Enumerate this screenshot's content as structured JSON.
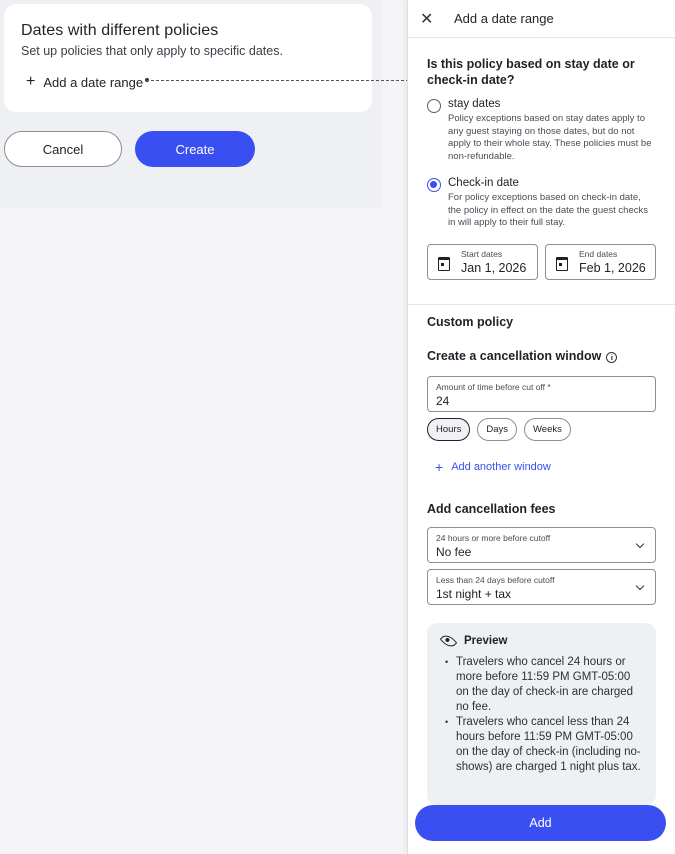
{
  "main": {
    "card_title": "Dates with different policies",
    "card_subtitle": "Set up policies that only apply to specific dates.",
    "add_date_range": "Add a date range",
    "cancel_label": "Cancel",
    "create_label": "Create"
  },
  "drawer": {
    "title": "Add a date range",
    "question": "Is this policy based on stay date or check-in date?",
    "options": [
      {
        "label": "stay dates",
        "desc": "Policy exceptions based on stay dates apply to any guest staying on those dates, but do not apply to their whole stay. These policies must be non-refundable.",
        "selected": false
      },
      {
        "label": "Check-in date",
        "desc": "For policy exceptions based on check-in date, the policy in effect on the date the guest checks in will apply to their full stay.",
        "selected": true
      }
    ],
    "start_label": "Start dates",
    "start_value": "Jan 1, 2026",
    "end_label": "End dates",
    "end_value": "Feb 1, 2026",
    "custom_policy": "Custom policy",
    "cancel_window_title": "Create a cancellation window",
    "amount_label": "Amount of time before cut off *",
    "amount_value": "24",
    "units": [
      "Hours",
      "Days",
      "Weeks"
    ],
    "selected_unit": "Hours",
    "add_window": "Add another window",
    "fees_title": "Add cancellation fees",
    "fee1_label": "24 hours or more before cutoff",
    "fee1_value": "No fee",
    "fee2_label": "Less than 24 days before cutoff",
    "fee2_value": "1st night + tax",
    "preview_title": "Preview",
    "preview_bullets": [
      "Travelers who cancel 24 hours or more before 11:59 PM GMT-05:00 on the day of check-in are charged no fee.",
      "Travelers who cancel less than 24 hours before 11:59 PM GMT-05:00 on the day of check-in (including no-shows) are charged 1 night plus tax."
    ],
    "add_label": "Add"
  },
  "colors": {
    "accent": "#3a4ff1"
  }
}
